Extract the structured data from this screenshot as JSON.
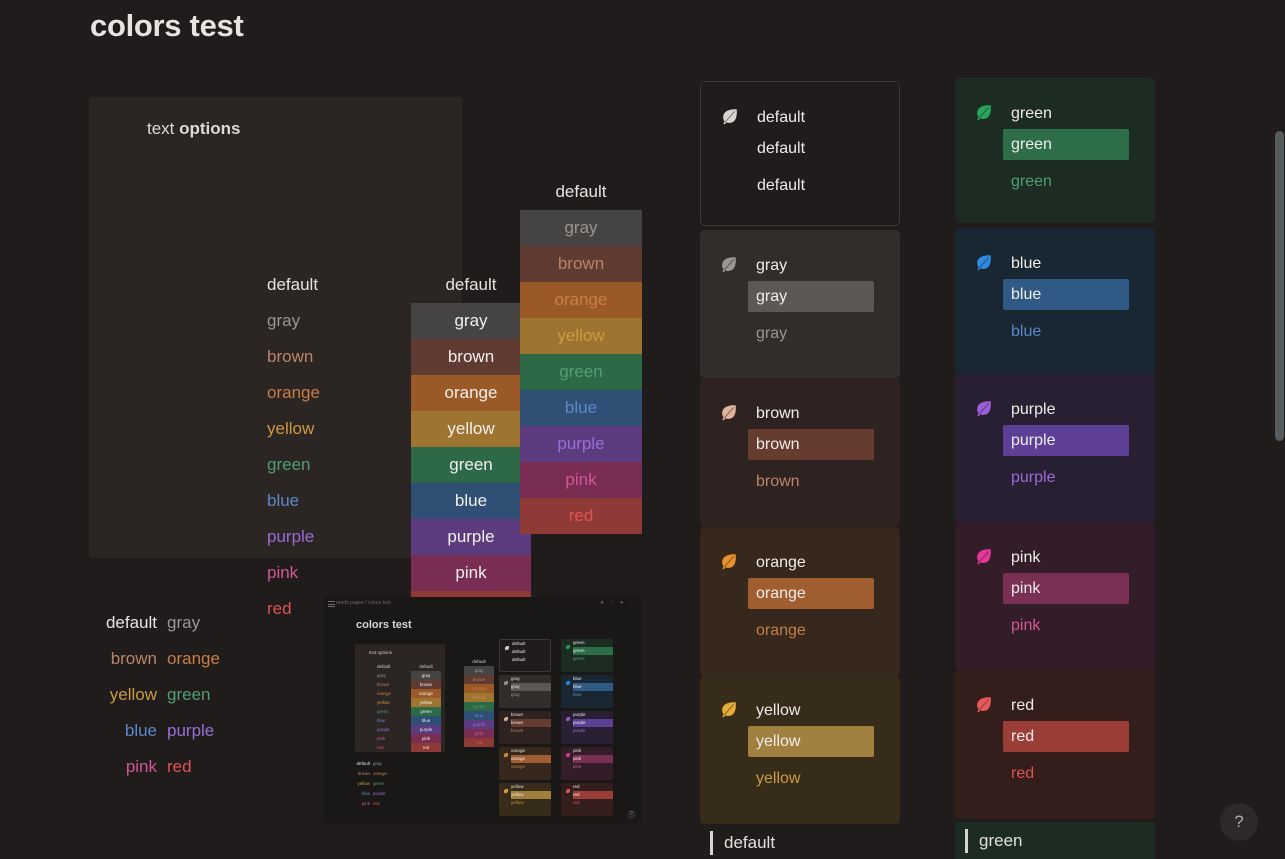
{
  "page": {
    "title": "colors test",
    "background": "#1f1c1b"
  },
  "options_panel": {
    "heading_normal": "text ",
    "heading_bold": "options",
    "column_plain_header": "default",
    "column_swatch_header": "default",
    "rows": [
      {
        "label": "gray",
        "text": "#9b9693",
        "bg": "#464442"
      },
      {
        "label": "brown",
        "text": "#ba856a",
        "bg": "#603b32"
      },
      {
        "label": "orange",
        "text": "#c77d46",
        "bg": "#9b5927"
      },
      {
        "label": "yellow",
        "text": "#ca9b42",
        "bg": "#9d7530"
      },
      {
        "label": "green",
        "text": "#529e72",
        "bg": "#2d6847"
      },
      {
        "label": "blue",
        "text": "#5e87c9",
        "bg": "#2f4f75"
      },
      {
        "label": "purple",
        "text": "#9a6dd7",
        "bg": "#5c3c7e"
      },
      {
        "label": "pink",
        "text": "#d15796",
        "bg": "#7a2d53"
      },
      {
        "label": "red",
        "text": "#df5452",
        "bg": "#8f3a36"
      }
    ]
  },
  "mid_column": {
    "header": "default",
    "rows": [
      {
        "label": "gray",
        "text": "#9b9693",
        "bg": "#464442"
      },
      {
        "label": "brown",
        "text": "#ba856a",
        "bg": "#603b32"
      },
      {
        "label": "orange",
        "text": "#c77d46",
        "bg": "#9b5927"
      },
      {
        "label": "yellow",
        "text": "#ca9b42",
        "bg": "#9d7530"
      },
      {
        "label": "green",
        "text": "#529e72",
        "bg": "#2d6847"
      },
      {
        "label": "blue",
        "text": "#5e87c9",
        "bg": "#2f4f75"
      },
      {
        "label": "purple",
        "text": "#9a6dd7",
        "bg": "#5c3c7e"
      },
      {
        "label": "pink",
        "text": "#d15796",
        "bg": "#7a2d53"
      },
      {
        "label": "red",
        "text": "#df5452",
        "bg": "#8f3a36"
      }
    ]
  },
  "word_grid": {
    "cells": [
      {
        "label": "default",
        "color": "#e6e3e0"
      },
      {
        "label": "gray",
        "color": "#9b9693"
      },
      {
        "label": "brown",
        "color": "#ba856a"
      },
      {
        "label": "orange",
        "color": "#c77d46"
      },
      {
        "label": "yellow",
        "color": "#ca9b42"
      },
      {
        "label": "green",
        "color": "#529e72"
      },
      {
        "label": "blue",
        "color": "#5e87c9"
      },
      {
        "label": "purple",
        "color": "#9a6dd7"
      },
      {
        "label": "pink",
        "color": "#d15796"
      },
      {
        "label": "red",
        "color": "#df5452"
      }
    ]
  },
  "thumbnail": {
    "breadcrumb": "rando pages / colors test",
    "share_label": "Share",
    "title": "colors test",
    "panel_heading": "text options",
    "help_label": "?",
    "rows": [
      {
        "label": "gray",
        "text": "#9b9693",
        "bg": "#464442"
      },
      {
        "label": "brown",
        "text": "#ba856a",
        "bg": "#603b32"
      },
      {
        "label": "orange",
        "text": "#c77d46",
        "bg": "#9b5927"
      },
      {
        "label": "yellow",
        "text": "#ca9b42",
        "bg": "#9d7530"
      },
      {
        "label": "green",
        "text": "#529e72",
        "bg": "#2d6847"
      },
      {
        "label": "blue",
        "text": "#5e87c9",
        "bg": "#2f4f75"
      },
      {
        "label": "purple",
        "text": "#9a6dd7",
        "bg": "#5c3c7e"
      },
      {
        "label": "pink",
        "text": "#d15796",
        "bg": "#7a2d53"
      },
      {
        "label": "red",
        "text": "#df5452",
        "bg": "#8f3a36"
      }
    ],
    "header_default": "default"
  },
  "callouts_left": [
    {
      "name": "default",
      "label": "default",
      "card_bg": "#1f1c1b",
      "card_border": "#3a3634",
      "leaf": "#d8d4d1",
      "highlight_bg": "transparent",
      "text_color": "#f0ecea"
    },
    {
      "name": "gray",
      "label": "gray",
      "card_bg": "#302d2b",
      "card_border": "transparent",
      "leaf": "#9b9693",
      "highlight_bg": "#5b5856",
      "text_color": "#9b9693"
    },
    {
      "name": "brown",
      "label": "brown",
      "card_bg": "#2e2320",
      "card_border": "transparent",
      "leaf": "#dfb49c",
      "highlight_bg": "#653c2f",
      "text_color": "#ba856a"
    },
    {
      "name": "orange",
      "label": "orange",
      "card_bg": "#36281c",
      "card_border": "transparent",
      "leaf": "#e8912e",
      "highlight_bg": "#a05d30",
      "text_color": "#c77d46"
    },
    {
      "name": "yellow",
      "label": "yellow",
      "card_bg": "#372c1a",
      "card_border": "transparent",
      "leaf": "#e5ad38",
      "highlight_bg": "#a07f3f",
      "text_color": "#ca9b42"
    }
  ],
  "callouts_right": [
    {
      "name": "green",
      "label": "green",
      "card_bg": "#1c2c22",
      "card_border": "transparent",
      "leaf": "#28a35a",
      "highlight_bg": "#2d6e48",
      "text_color": "#529e72"
    },
    {
      "name": "blue",
      "label": "blue",
      "card_bg": "#192733",
      "card_border": "transparent",
      "leaf": "#2f8ae0",
      "highlight_bg": "#2f5a86",
      "text_color": "#5e87c9"
    },
    {
      "name": "purple",
      "label": "purple",
      "card_bg": "#291f33",
      "card_border": "transparent",
      "leaf": "#9a5fd9",
      "highlight_bg": "#5e3f96",
      "text_color": "#9a6dd7"
    },
    {
      "name": "pink",
      "label": "pink",
      "card_bg": "#321d28",
      "card_border": "transparent",
      "leaf": "#e5379a",
      "highlight_bg": "#7a2f55",
      "text_color": "#d15796"
    },
    {
      "name": "red",
      "label": "red",
      "card_bg": "#331e1c",
      "card_border": "transparent",
      "leaf": "#e8595a",
      "highlight_bg": "#9c3e38",
      "text_color": "#df5452"
    }
  ],
  "quotes": [
    {
      "label": "default",
      "bg": "transparent",
      "bar": "#d8d4d1"
    },
    {
      "label": "green",
      "bg": "#1c2c22",
      "bar": "#d8d4d1"
    }
  ],
  "help": {
    "label": "?"
  }
}
